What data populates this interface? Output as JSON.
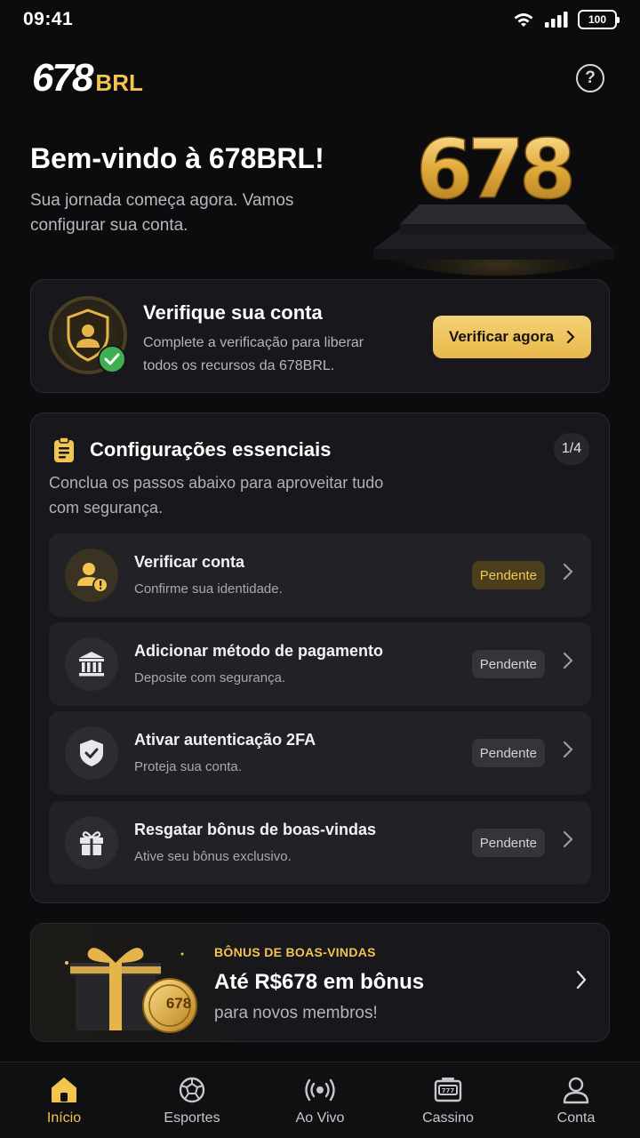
{
  "status_bar": {
    "time": "09:41",
    "battery": "100"
  },
  "header": {
    "logo_number": "678",
    "logo_suffix": "BRL",
    "help_icon": "help-circle-icon"
  },
  "hero": {
    "title": "Bem-vindo à 678BRL!",
    "subtitle": "Sua jornada começa agora. Vamos configurar sua conta.",
    "art_text": "678"
  },
  "verify": {
    "title": "Verifique sua conta",
    "description": "Complete a verificação para liberar todos os recursos da 678BRL.",
    "button_label": "Verificar agora"
  },
  "setup": {
    "title": "Configurações essenciais",
    "progress": "1/4",
    "subtitle": "Conclua os passos abaixo para aproveitar tudo com segurança.",
    "steps": [
      {
        "title": "Verificar conta",
        "description": "Confirme sua identidade.",
        "status": "Pendente",
        "icon": "user-alert-icon"
      },
      {
        "title": "Adicionar método de pagamento",
        "description": "Deposite com segurança.",
        "status": "Pendente",
        "icon": "bank-icon"
      },
      {
        "title": "Ativar autenticação 2FA",
        "description": "Proteja sua conta.",
        "status": "Pendente",
        "icon": "shield-check-icon"
      },
      {
        "title": "Resgatar bônus de boas-vindas",
        "description": "Ative seu bônus exclusivo.",
        "status": "Pendente",
        "icon": "gift-icon"
      }
    ]
  },
  "bonus": {
    "label": "BÔNUS DE BOAS-VINDAS",
    "title": "Até R$678 em bônus",
    "subtitle": "para novos membros!",
    "coin_text": "678"
  },
  "tabs": [
    {
      "label": "Início",
      "icon": "home-icon",
      "active": true
    },
    {
      "label": "Esportes",
      "icon": "soccer-ball-icon",
      "active": false
    },
    {
      "label": "Ao Vivo",
      "icon": "live-broadcast-icon",
      "active": false
    },
    {
      "label": "Cassino",
      "icon": "slot-machine-icon",
      "active": false
    },
    {
      "label": "Conta",
      "icon": "user-icon",
      "active": false
    }
  ],
  "colors": {
    "accent": "#f2c450",
    "background": "#0c0c0e",
    "card": "#18181c",
    "success": "#3fb04f"
  }
}
